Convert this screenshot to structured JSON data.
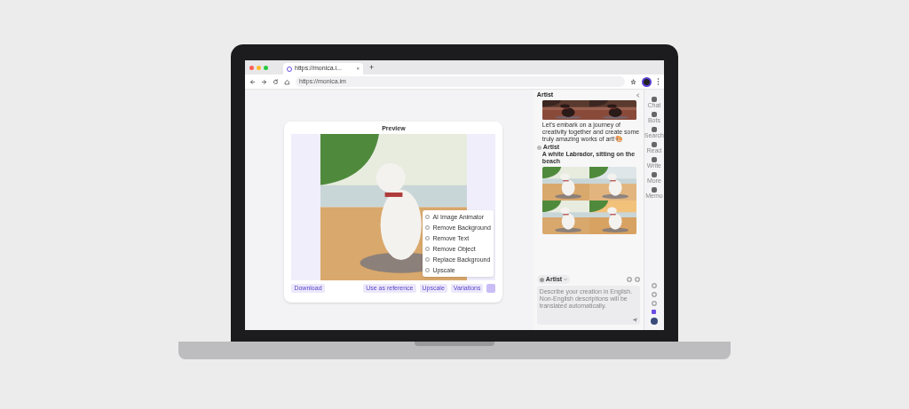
{
  "browser": {
    "tab": {
      "title": "https://monica.i...",
      "close": "×"
    },
    "new_tab": "+",
    "url": "https://monica.im"
  },
  "preview": {
    "title": "Preview",
    "menu": [
      {
        "label": "AI Image Animator"
      },
      {
        "label": "Remove Background"
      },
      {
        "label": "Remove Text"
      },
      {
        "label": "Remove Object"
      },
      {
        "label": "Replace Background"
      },
      {
        "label": "Upscale"
      }
    ],
    "left_button": "Download",
    "buttons": [
      "Use as reference",
      "Upscale",
      "Variations"
    ]
  },
  "chat": {
    "title": "Artist",
    "message": "Let's embark on a journey of creativity together and create some truly amazing works of art!🎨",
    "sender": "Artist",
    "prompt": "A white Labrador, sitting on the beach",
    "bot_select": "Artist",
    "input": {
      "placeholder": "Describe your creation in English. Non-English descriptions will be translated automatically."
    }
  },
  "rail": [
    {
      "label": "Chat",
      "selected": false
    },
    {
      "label": "Bots",
      "selected": false
    },
    {
      "label": "Search",
      "selected": false
    },
    {
      "label": "Read",
      "selected": false
    },
    {
      "label": "Write",
      "selected": false
    },
    {
      "label": "More",
      "selected": false
    },
    {
      "label": "Memo",
      "selected": false
    }
  ]
}
